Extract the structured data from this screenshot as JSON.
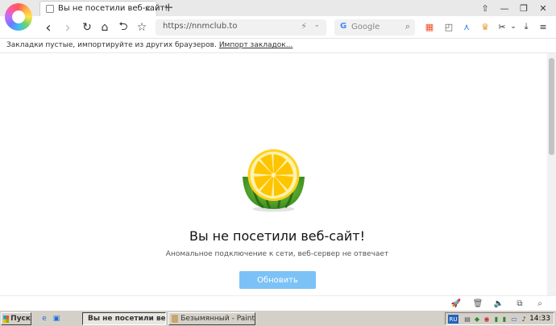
{
  "tab": {
    "title": "Вы не посетили веб-сайт!",
    "close": "×"
  },
  "new_tab": "+",
  "window_buttons": [
    "⇧",
    "—",
    "❐",
    "✕"
  ],
  "nav": {
    "back": "‹",
    "forward": "›",
    "reload": "↻",
    "home": "⌂",
    "undo": "⮌",
    "star": "☆"
  },
  "address": {
    "url": "https://nnmclub.to",
    "bolt": "⚡",
    "dropdown": "⌄"
  },
  "search": {
    "engine_icon": "G",
    "placeholder": "Google",
    "icon": "⌕"
  },
  "extensions": [
    "▦",
    "◰",
    "⋏",
    "♛",
    "✂",
    "⌄",
    "⤓",
    "≡"
  ],
  "bookmarks_bar": {
    "text": "Закладки пустые, импортируйте из других браузеров.",
    "link": "Импорт закладок..."
  },
  "error": {
    "title": "Вы не посетили веб-сайт!",
    "subtitle": "Аномальное подключение к сети, веб-сервер не отвечает",
    "button": "Обновить"
  },
  "statusbar_icons": [
    "rocket-icon",
    "trash-icon",
    "speaker-icon",
    "copy-icon",
    "zoom-icon"
  ],
  "statusbar_glyphs": [
    "🚀",
    "🗑",
    "🔈",
    "⧉",
    "⌕"
  ],
  "taskbar": {
    "start": "Пуск",
    "tasks": [
      {
        "label": "Вы не посетили веб-сайт!"
      },
      {
        "label": "Безымянный - Paint"
      }
    ],
    "lang": "RU",
    "clock": "14:33"
  },
  "colors": {
    "accent_button": "#7cc2f7",
    "taskbar": "#d4d0c8"
  }
}
